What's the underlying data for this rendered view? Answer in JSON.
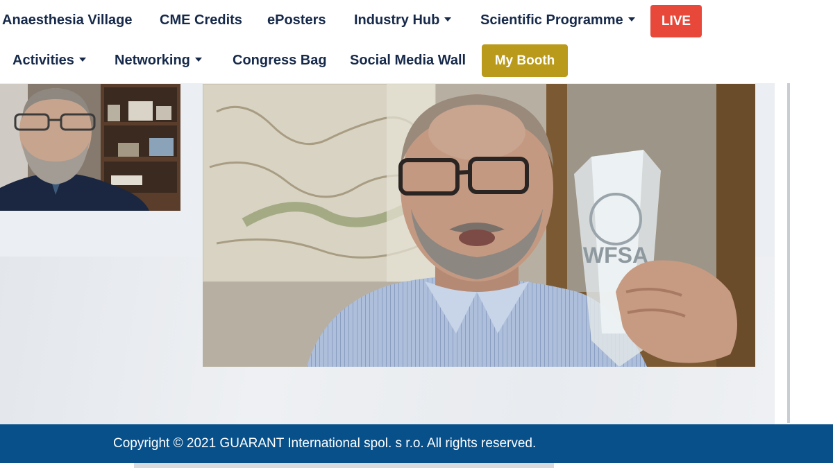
{
  "nav": {
    "row1": {
      "anaesthesia_village": "Anaesthesia Village",
      "cme_credits": "CME Credits",
      "eposters": "ePosters",
      "industry_hub": "Industry Hub",
      "scientific_programme": "Scientific Programme",
      "live": "LIVE"
    },
    "row2": {
      "activities": "Activities",
      "networking": "Networking",
      "congress_bag": "Congress Bag",
      "social_media_wall": "Social Media Wall",
      "my_booth": "My Booth"
    }
  },
  "video": {
    "award_engraving": "WFSA"
  },
  "footer": {
    "copyright": "Copyright © 2021 GUARANT International spol. s r.o. All rights reserved."
  },
  "colors": {
    "nav_text": "#16294a",
    "live_button": "#e8483a",
    "my_booth_button": "#b99a1a",
    "footer_bg": "#07508a"
  },
  "icons": {
    "dropdown": "chevron-down-icon"
  }
}
